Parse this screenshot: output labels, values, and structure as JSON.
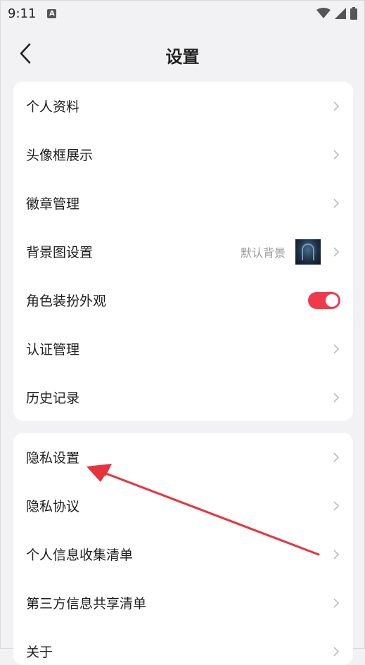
{
  "status_bar": {
    "time": "9:11",
    "notification_badge": "A",
    "icons": [
      "wifi-icon",
      "signal-icon",
      "battery-icon"
    ]
  },
  "header": {
    "title": "设置",
    "back_icon": "chevron-left-icon"
  },
  "sections": [
    {
      "items": [
        {
          "label": "个人资料",
          "right": "chevron"
        },
        {
          "label": "头像框展示",
          "right": "chevron"
        },
        {
          "label": "徽章管理",
          "right": "chevron"
        },
        {
          "label": "背景图设置",
          "value": "默认背景",
          "right": "chevron"
        },
        {
          "label": "角色装扮外观",
          "right": "toggle",
          "toggle_on": true
        },
        {
          "label": "认证管理",
          "right": "chevron"
        },
        {
          "label": "历史记录",
          "right": "chevron"
        }
      ]
    },
    {
      "items": [
        {
          "label": "隐私设置",
          "right": "chevron"
        },
        {
          "label": "隐私协议",
          "right": "chevron"
        },
        {
          "label": "个人信息收集清单",
          "right": "chevron"
        },
        {
          "label": "第三方信息共享清单",
          "right": "chevron"
        },
        {
          "label": "关于",
          "right": "chevron"
        }
      ]
    }
  ],
  "colors": {
    "accent": "#f03a4c",
    "annotation_arrow": "#e8333b",
    "background": "#f2f2f4",
    "card": "#ffffff"
  }
}
